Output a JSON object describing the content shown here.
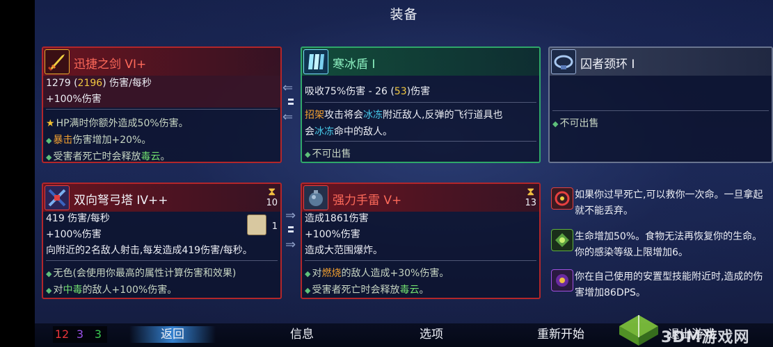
{
  "screen": {
    "title": "装备"
  },
  "items": {
    "weapon1": {
      "name": "迅捷之剑 VI+",
      "dps_prefix": "1279 (",
      "dps_alt": "2196",
      "dps_suffix": ") 伤害/每秒",
      "bonus": "+100%伤害",
      "affix1_a": "HP满时你额外造成50%伤害。",
      "affix2_a": "暴击",
      "affix2_b": "伤害增加+20%。",
      "affix3_a": "受害者死亡时会释放",
      "affix3_b": "毒云",
      "affix3_c": "。"
    },
    "shield": {
      "name": "寒冰盾 I",
      "stat_a": "吸收75%伤害 - 26 (",
      "stat_alt": "53",
      "stat_b": ")伤害",
      "desc1_a": "招架",
      "desc1_b": "攻击将会",
      "desc1_c": "冰冻",
      "desc1_d": "附近敌人,反弹的飞行道具也",
      "desc2_a": "会",
      "desc2_b": "冰冻",
      "desc2_c": "命中的敌人。",
      "unsellable": "不可出售"
    },
    "amulet": {
      "name": "囚者颈环 I",
      "unsellable": "不可出售"
    },
    "skill1": {
      "name": "双向弩弓塔 IV++",
      "cooldown": "10",
      "scroll_count": "1",
      "dps": "419 伤害/每秒",
      "bonus": "+100%伤害",
      "desc": "向附近的2名敌人射击,每发造成419伤害/每秒。",
      "affix1": "无色(会使用你最高的属性计算伤害和效果)",
      "affix2_a": "对",
      "affix2_b": "中毒",
      "affix2_c": "的敌人+100%伤害。"
    },
    "skill2": {
      "name": "强力手雷 V+",
      "cooldown": "13",
      "damage": "造成1861伤害",
      "bonus": "+100%伤害",
      "desc": "造成大范围爆炸。",
      "affix1_a": "对",
      "affix1_b": "燃烧",
      "affix1_c": "的敌人造成+30%伤害。",
      "affix2_a": "受害者死亡时会释放",
      "affix2_b": "毒云",
      "affix2_c": "。"
    }
  },
  "mutations": [
    {
      "text": "如果你过早死亡,可以救你一次命。一旦拿起就不能丢弃。"
    },
    {
      "text": "生命增加50%。食物无法再恢复你的生命。你的感染等级上限增加6。"
    },
    {
      "text": "你在自己使用的安置型技能附近时,造成的伤害增加86DPS。"
    }
  ],
  "stats": {
    "brutality": "12",
    "tactics": "3",
    "survival": "3"
  },
  "menu": {
    "back": "返回",
    "info": "信息",
    "options": "选项",
    "restart": "重新开始",
    "quit": "退出游戏"
  },
  "watermark": {
    "text": "3DM游戏网"
  },
  "colors": {
    "brutality": "#e8343a",
    "tactics": "#9a50e8",
    "survival": "#3ac850",
    "red_border": "#b3262a",
    "green_border": "#2fa86a",
    "gray_border": "#6a7590"
  }
}
